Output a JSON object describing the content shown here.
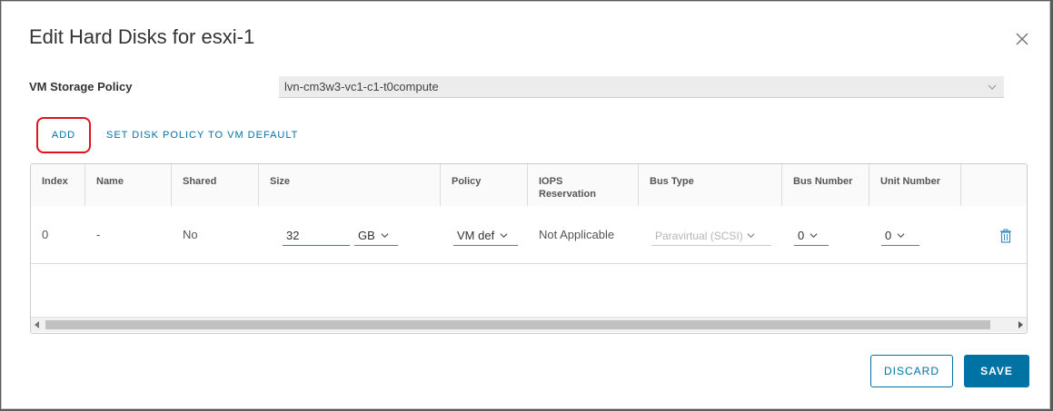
{
  "dialog": {
    "title": "Edit Hard Disks for esxi-1",
    "close_icon": "close-icon"
  },
  "storage_policy": {
    "label": "VM Storage Policy",
    "value": "lvn-cm3w3-vc1-c1-t0compute"
  },
  "actions": {
    "add_label": "ADD",
    "set_default_label": "SET DISK POLICY TO VM DEFAULT"
  },
  "grid": {
    "columns": [
      {
        "label": "Index"
      },
      {
        "label": "Name"
      },
      {
        "label": "Shared"
      },
      {
        "label": "Size"
      },
      {
        "label": "Policy"
      },
      {
        "label": "IOPS Reservation"
      },
      {
        "label": "Bus Type"
      },
      {
        "label": "Bus Number"
      },
      {
        "label": "Unit Number"
      },
      {
        "label": ""
      }
    ],
    "rows": [
      {
        "index": "0",
        "name": "-",
        "shared": "No",
        "size_value": "32",
        "size_unit": "GB",
        "policy": "VM def",
        "iops": "Not Applicable",
        "bus_type": "Paravirtual (SCSI)",
        "bus_number": "0",
        "unit_number": "0",
        "delete_icon": "trash-icon"
      }
    ]
  },
  "footer": {
    "discard_label": "DISCARD",
    "save_label": "SAVE"
  },
  "colors": {
    "accent": "#0072a3",
    "highlight": "#e0141e"
  }
}
